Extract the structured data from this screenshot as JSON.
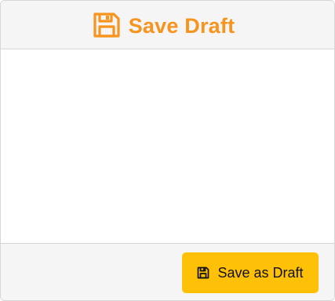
{
  "header": {
    "title": "Save Draft",
    "icon": "floppy-disk-icon",
    "accent_color": "#f7941d"
  },
  "footer": {
    "save_button": {
      "label": "Save as Draft",
      "icon": "floppy-disk-icon",
      "background_color": "#ffc107"
    }
  }
}
